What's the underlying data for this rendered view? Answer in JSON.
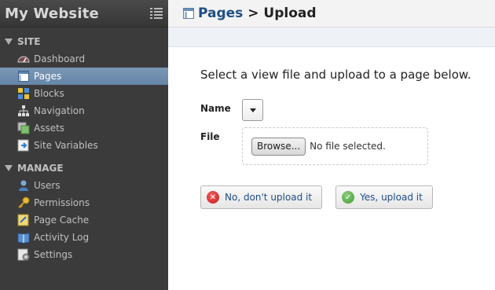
{
  "sidebar": {
    "title": "My Website",
    "sections": [
      {
        "label": "SITE",
        "items": [
          {
            "label": "Dashboard",
            "icon": "dashboard-icon"
          },
          {
            "label": "Pages",
            "icon": "pages-icon",
            "active": true
          },
          {
            "label": "Blocks",
            "icon": "blocks-icon"
          },
          {
            "label": "Navigation",
            "icon": "navigation-icon"
          },
          {
            "label": "Assets",
            "icon": "assets-icon"
          },
          {
            "label": "Site Variables",
            "icon": "site-variables-icon"
          }
        ]
      },
      {
        "label": "MANAGE",
        "items": [
          {
            "label": "Users",
            "icon": "users-icon"
          },
          {
            "label": "Permissions",
            "icon": "key-icon"
          },
          {
            "label": "Page Cache",
            "icon": "page-cache-icon"
          },
          {
            "label": "Activity Log",
            "icon": "book-icon"
          },
          {
            "label": "Settings",
            "icon": "settings-icon"
          }
        ]
      }
    ]
  },
  "header": {
    "crumb_link": "Pages",
    "crumb_sep": " > ",
    "crumb_current": "Upload"
  },
  "form": {
    "instructions": "Select a view file and upload to a page below.",
    "name_label": "Name",
    "name_value": "",
    "file_label": "File",
    "browse_label": "Browse...",
    "no_file_text": "No file selected."
  },
  "actions": {
    "no_label": "No, don't upload it",
    "yes_label": "Yes, upload it"
  },
  "colors": {
    "sidebar_bg": "#3b3b3b",
    "active_item_bg": "#6f8cad",
    "link": "#1f4e85"
  }
}
